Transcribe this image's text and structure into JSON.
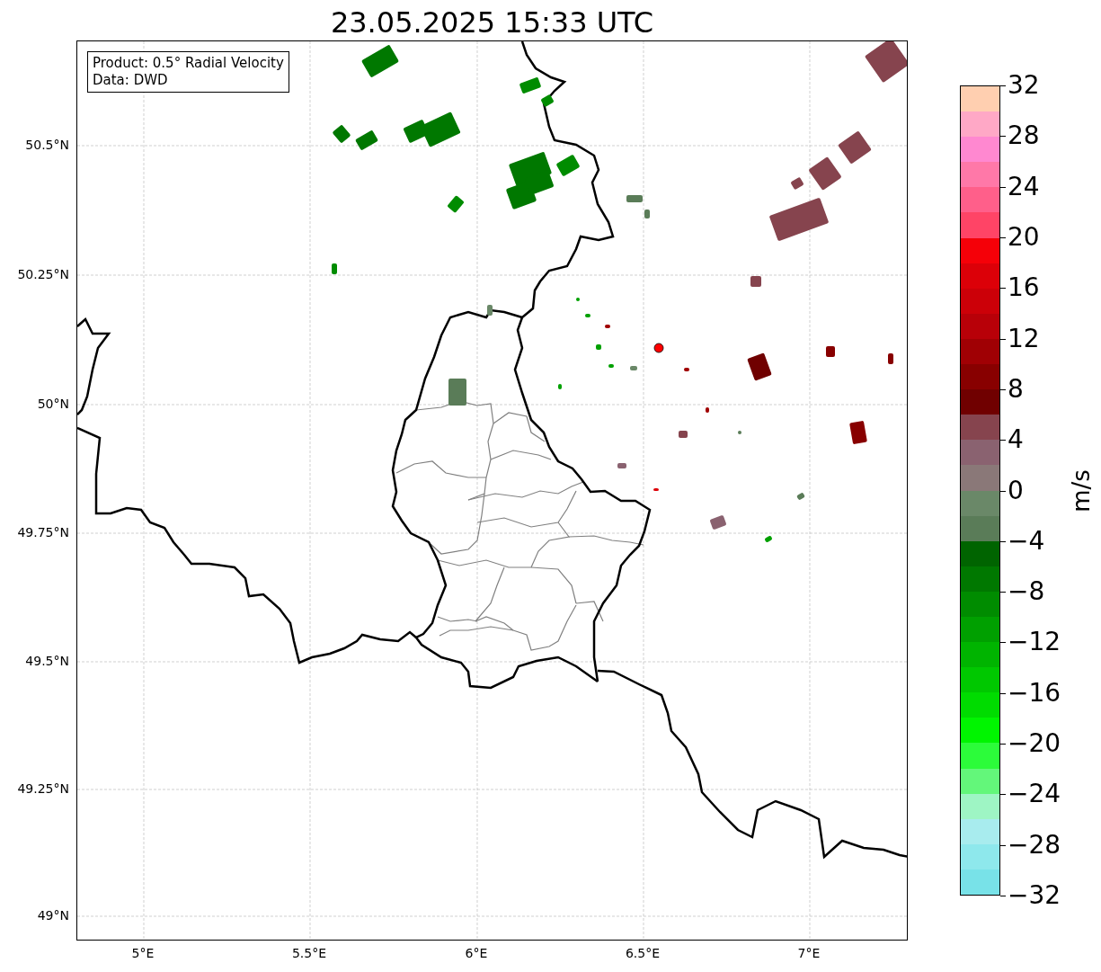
{
  "title": "23.05.2025 15:33 UTC",
  "info_box": {
    "lines": [
      "Product: 0.5° Radial Velocity",
      "Data: DWD"
    ]
  },
  "map": {
    "latitude_labels": [
      "50.5°N",
      "50.25°N",
      "50°N",
      "49.75°N",
      "49.5°N",
      "49.25°N",
      "49°N"
    ],
    "longitude_labels": [
      "5°E",
      "5.5°E",
      "6°E",
      "6.5°E",
      "7°E"
    ]
  },
  "colorbar": {
    "label": "m/s",
    "tick_labels": [
      "32",
      "28",
      "24",
      "20",
      "16",
      "12",
      "8",
      "4",
      "0",
      "−4",
      "−8",
      "−12",
      "−16",
      "−20",
      "−24",
      "−28",
      "−32"
    ],
    "bands": [
      {
        "color": "#ffcfb0"
      },
      {
        "color": "#ffa8c6"
      },
      {
        "color": "#ff88d0"
      },
      {
        "color": "#ff78a8"
      },
      {
        "color": "#ff5f8a"
      },
      {
        "color": "#ff4466"
      },
      {
        "color": "#f50008"
      },
      {
        "color": "#dc0008"
      },
      {
        "color": "#cc0008"
      },
      {
        "color": "#b80008"
      },
      {
        "color": "#a00004"
      },
      {
        "color": "#880000"
      },
      {
        "color": "#700000"
      },
      {
        "color": "#86444e"
      },
      {
        "color": "#8a6270"
      },
      {
        "color": "#8a7878"
      },
      {
        "color": "#6a8868"
      },
      {
        "color": "#5a7c58"
      },
      {
        "color": "#006400"
      },
      {
        "color": "#007800"
      },
      {
        "color": "#008c00"
      },
      {
        "color": "#00a000"
      },
      {
        "color": "#00b400"
      },
      {
        "color": "#00c800"
      },
      {
        "color": "#00dc00"
      },
      {
        "color": "#00f500"
      },
      {
        "color": "#2cfc3a"
      },
      {
        "color": "#63f77a"
      },
      {
        "color": "#9ef5c4"
      },
      {
        "color": "#a8ecee"
      },
      {
        "color": "#8ee8ec"
      },
      {
        "color": "#78e2e8"
      }
    ]
  }
}
